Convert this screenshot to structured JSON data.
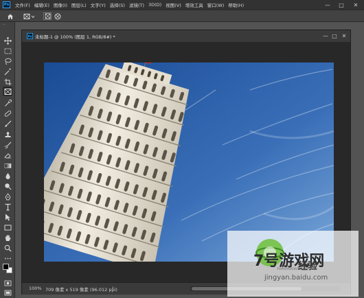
{
  "app": {
    "logo": "Ps"
  },
  "menu": [
    "文件(F)",
    "编辑(E)",
    "图像(I)",
    "图层(L)",
    "文字(Y)",
    "选择(S)",
    "滤镜(T)",
    "3D(D)",
    "视图(V)",
    "增效工具",
    "窗口(W)",
    "帮助(H)"
  ],
  "window_controls": {
    "minimize": "—",
    "maximize": "□",
    "close": "✕"
  },
  "document": {
    "tab_title": "未标题-1 @ 100% (图层 1, RGB/8#) *",
    "zoom": "100%",
    "info": "709 像素 x 519 像素 (96.012 ppi)",
    "arrow": "›"
  },
  "watermark": {
    "title": "7号游戏网",
    "subtitle": "7HAOYOUXIWANG",
    "jingyan": "经验",
    "url": "jingyan.baidu.com"
  },
  "colors": {
    "sky_top": "#1a4b95",
    "sky_bottom": "#6f9ed2",
    "tower": "#e9e3d3",
    "accent": "#31a8ff"
  }
}
